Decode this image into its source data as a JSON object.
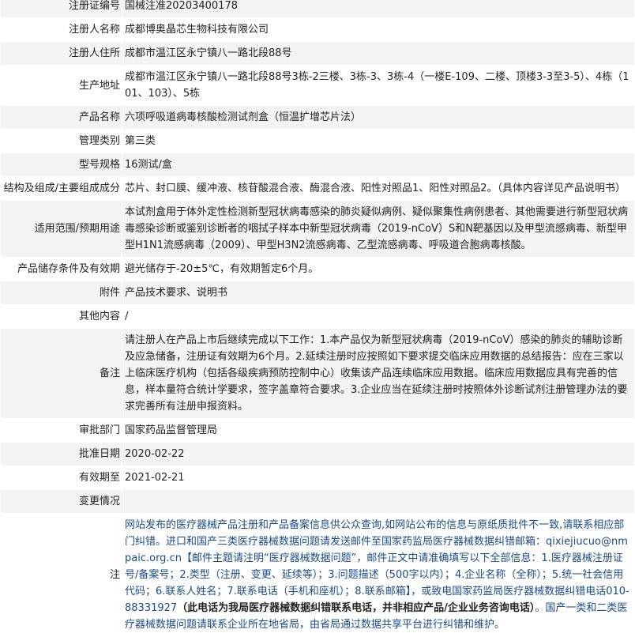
{
  "record": {
    "rows": [
      {
        "label": "注册证编号",
        "value": "国械注准20203400178"
      },
      {
        "label": "注册人名称",
        "value": "成都博奥晶芯生物科技有限公司"
      },
      {
        "label": "注册人住所",
        "value": "成都市温江区永宁镇八一路北段88号"
      },
      {
        "label": "生产地址",
        "value": "成都市温江区永宁镇八一路北段88号3栋-2三楼、3栋-3、3栋-4（一楼E-109、二楼、顶楼3-3至3-5）、4栋（101、103）、5栋"
      },
      {
        "label": "产品名称",
        "value": "六项呼吸道病毒核酸检测试剂盒（恒温扩增芯片法）"
      },
      {
        "label": "管理类别",
        "value": "第三类"
      },
      {
        "label": "型号规格",
        "value": "16测试/盒"
      },
      {
        "label": "结构及组成/主要组成成分",
        "value": "芯片、封口膜、缓冲液、核苷酸混合液、酶混合液、阳性对照品1、阳性对照品2。（具体内容详见产品说明书）"
      },
      {
        "label": "适用范围/预期用途",
        "value": "本试剂盒用于体外定性检测新型冠状病毒感染的肺炎疑似病例、疑似聚集性病例患者、其他需要进行新型冠状病毒感染诊断或鉴别诊断者的咽拭子样本中新型冠状病毒（2019-nCoV）S和N靶基因以及甲型流感病毒、新型甲型H1N1流感病毒（2009）、甲型H3N2流感病毒、乙型流感病毒、呼吸道合胞病毒核酸。"
      },
      {
        "label": "产品储存条件及有效期",
        "value": "避光储存于-20±5℃，有效期暂定6个月。"
      },
      {
        "label": "附件",
        "value": "产品技术要求、说明书"
      },
      {
        "label": "其他内容",
        "value": "/"
      },
      {
        "label": "备注",
        "value": "请注册人在产品上市后继续完成以下工作：1.本产品仅为新型冠状病毒（2019-nCoV）感染的肺炎的辅助诊断及应急储备，注册证有效期为6个月。2.延续注册时应按照如下要求提交临床应用数据的总结报告：应在三家以上临床医疗机构（包括各级疾病预防控制中心）收集该产品连续临床应用数据。临床应用数据应具有完善的信息，样本量符合统计学要求，签字盖章符合要求。3.企业应当在延续注册时按照体外诊断试剂注册管理办法的要求完善所有注册申报资料。"
      },
      {
        "label": "审批部门",
        "value": "国家药品监督管理局"
      },
      {
        "label": "批准日期",
        "value": "2020-02-22"
      },
      {
        "label": "有效期至",
        "value": "2021-02-21"
      },
      {
        "label": "变更情况",
        "value": ""
      }
    ],
    "note": {
      "label": "注",
      "part1": "网站发布的医疗器械产品注册和产品备案信息供公众查询,如网站公布的信息与原纸质批件不一致,请联系相应部门纠错。进口和国产三类医疗器械数据问题请发送邮件至国家药监局医疗器械数据纠错邮箱：qixiejiucuo@nmpaic.org.cn【邮件主题请注明“医疗器械数据问题”，邮件正文中请准确填写以下全部信息：1.医疗器械注册证号/备案号；2.类型（注册、变更、延续等）；3.问题描述（500字以内）；4.企业名称（全称）；5.统一社会信用代码；6.联系人姓名；7.联系电话（手机和座机）；8.联系邮箱】，或致电国家药监局医疗器械数据纠错电话010-88331927",
      "part2_bold": "（此电话为我局医疗器械数据纠错联系电话，并非相应产品/企业业务咨询电话）",
      "part3": "。国产一类和二类医疗器械数据问题请联系企业所在地省局，由省局通过数据共享平台进行纠错和维护。"
    }
  }
}
